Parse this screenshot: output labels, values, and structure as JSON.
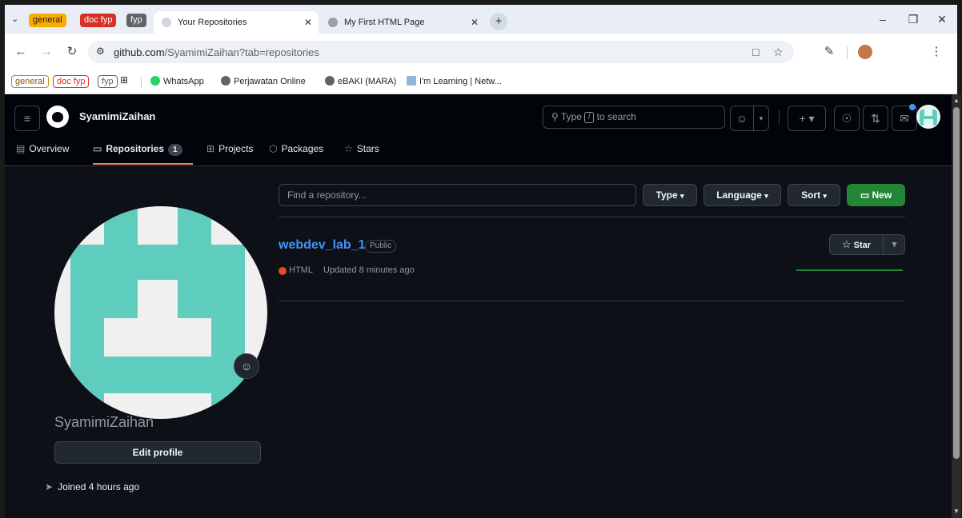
{
  "browser": {
    "tab_groups": [
      {
        "label": "general",
        "color": "#f9ab00",
        "text_color": "#1f1f1f"
      },
      {
        "label": "doc fyp",
        "color": "#d93025",
        "text_color": "#ffffff"
      },
      {
        "label": "fyp",
        "color": "#5f6368",
        "text_color": "#ffffff"
      }
    ],
    "tabs": [
      {
        "title": "Your Repositories",
        "active": true
      },
      {
        "title": "My First HTML Page",
        "active": false
      }
    ],
    "new_tab": "+",
    "url_host": "github.com",
    "url_rest": "/SyamimiZaihan?tab=repositories",
    "bookmarks": [
      {
        "label": "WhatsApp"
      },
      {
        "label": "Perjawatan Online"
      },
      {
        "label": "eBAKI (MARA)"
      },
      {
        "label": "I'm Learning | Netw..."
      }
    ],
    "bookmark_groups": [
      {
        "label": "general",
        "color": "#c58a00"
      },
      {
        "label": "doc fyp",
        "color": "#d93025"
      },
      {
        "label": "fyp",
        "color": "#5f6368"
      }
    ]
  },
  "header": {
    "username": "SyamimiZaihan",
    "search_prefix": "Type",
    "search_key": "/",
    "search_suffix": "to search"
  },
  "profile_nav": {
    "tabs": [
      {
        "label": "Overview",
        "icon": "book-icon"
      },
      {
        "label": "Repositories",
        "icon": "repo-icon",
        "count": "1",
        "selected": true
      },
      {
        "label": "Projects",
        "icon": "table-icon"
      },
      {
        "label": "Packages",
        "icon": "package-icon"
      },
      {
        "label": "Stars",
        "icon": "star-icon"
      }
    ]
  },
  "sidebar": {
    "name": "SyamimiZaihan",
    "edit_profile": "Edit profile",
    "joined": "Joined 4 hours ago",
    "avatar_color": "#5fcdbd"
  },
  "repos": {
    "filter_placeholder": "Find a repository...",
    "type_label": "Type",
    "language_label": "Language",
    "sort_label": "Sort",
    "new_label": "New",
    "items": [
      {
        "name": "webdev_lab_1",
        "visibility": "Public",
        "language": "HTML",
        "language_color": "#e34c26",
        "updated": "Updated 8 minutes ago",
        "star_label": "Star"
      }
    ]
  }
}
